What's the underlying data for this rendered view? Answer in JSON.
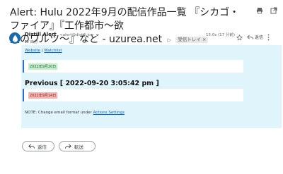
{
  "subject": {
    "line1": "Alert: Hulu 2022年9月の配信作品一覧 『シカゴ・ファイア』『工作都市〜欲",
    "line2": "望のワルツ〜』など - uzurea.net",
    "label": "受信トレイ ×"
  },
  "sender": {
    "name": "Distill Alert",
    "address": "<alert@distill.io>",
    "to": "To 自分 ▾"
  },
  "message": {
    "time": "15:0s (17 分前)",
    "reply_label": "返信"
  },
  "body": {
    "website_link": "Website",
    "separator": " | ",
    "watchlist_link": "Watchlist",
    "current_tag": "2022年9月20日",
    "previous_title": "Previous [ 2022-09-20 3:05:42 pm ]",
    "previous_tag": "2022年9月14日",
    "note_text": "NOTE: Change email format under ",
    "note_link": "Actions Settings"
  },
  "buttons": {
    "reply": "返信",
    "forward": "転送"
  },
  "colors": {
    "body_bg": "#e0f4fc",
    "accent_blue": "#2a6cd3",
    "tag_green": "#c5eccd",
    "tag_red": "#f3b3b3",
    "avatar": "#1769b1"
  }
}
